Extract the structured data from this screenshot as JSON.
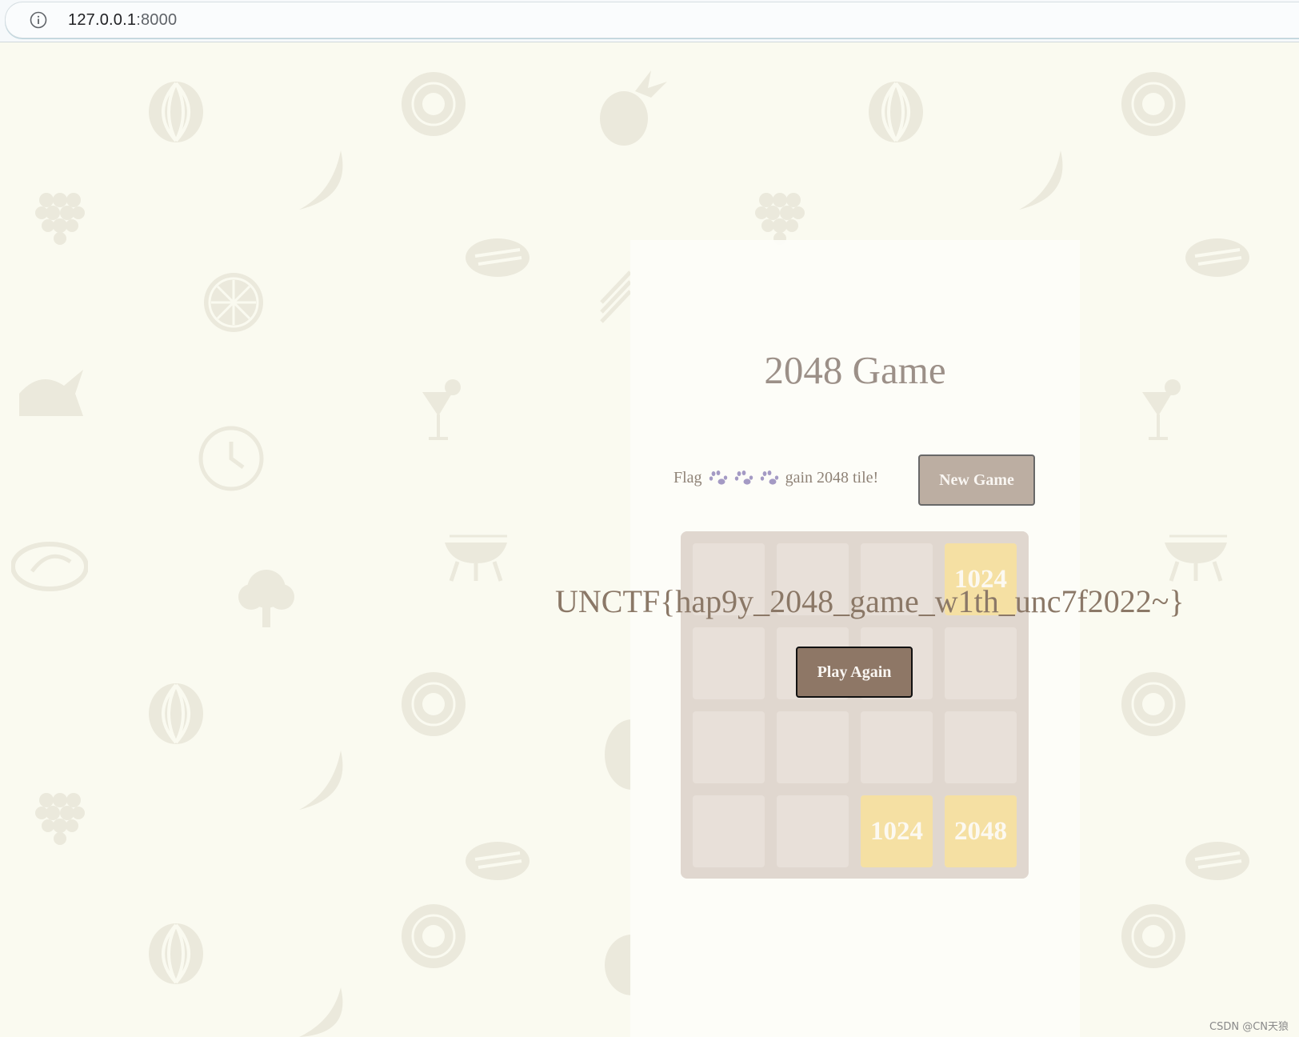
{
  "browser": {
    "url_host": "127.0.0.1",
    "url_port": ":8000"
  },
  "game": {
    "title": "2048 Game",
    "intro_prefix": "Flag",
    "intro_suffix": "gain 2048 tile!",
    "new_game_label": "New Game",
    "flag_text": "UNCTF{hap9y_2048_game_w1th_unc7f2022~}",
    "play_again_label": "Play Again",
    "grid_rows": [
      [
        "",
        "",
        "",
        "1024"
      ],
      [
        "",
        "",
        "",
        ""
      ],
      [
        "",
        "",
        "",
        ""
      ],
      [
        "",
        "",
        "1024",
        "2048"
      ]
    ],
    "tile_color": "#f3d98a"
  },
  "watermark": "CSDN @CN天狼"
}
